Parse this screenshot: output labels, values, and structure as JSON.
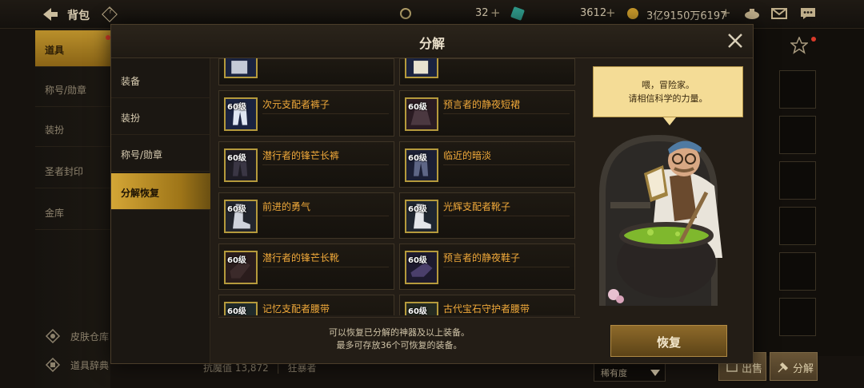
{
  "topbar": {
    "title": "背包",
    "currency1": "32",
    "currency2": "3612",
    "currency3": "3亿9150万6197",
    "plus": "+"
  },
  "leftnav": {
    "items": [
      "道具",
      "称号/勋章",
      "装扮",
      "圣者封印",
      "金库"
    ],
    "bottom": [
      "皮肤仓库",
      "道具辞典"
    ]
  },
  "background": {
    "stat_label": "抗魔值 13,872",
    "stat_sep": "|",
    "stat_class": "狂暴者",
    "sort_label": "稀有度",
    "btn_bag": "出售",
    "btn_decompose": "分解"
  },
  "modal": {
    "title": "分解",
    "tabs": [
      "装备",
      "装扮",
      "称号/勋章",
      "分解恢复"
    ],
    "items": [
      {
        "level": "60级",
        "name": "次元支配者裤子"
      },
      {
        "level": "60级",
        "name": "预言者的静夜短裙"
      },
      {
        "level": "60级",
        "name": "潜行者的锋芒长裤"
      },
      {
        "level": "60级",
        "name": "临近的暗淡"
      },
      {
        "level": "60级",
        "name": "前进的勇气"
      },
      {
        "level": "60级",
        "name": "光辉支配者靴子"
      },
      {
        "level": "60级",
        "name": "潜行者的锋芒长靴"
      },
      {
        "level": "60级",
        "name": "预言者的静夜鞋子"
      },
      {
        "level": "60级",
        "name": "记忆支配者腰带"
      },
      {
        "level": "60级",
        "name": "古代宝石守护者腰带"
      }
    ],
    "footer_line1": "可以恢复已分解的神器及以上装备。",
    "footer_line2": "最多可存放36个可恢复的装备。",
    "npc_line1": "喂，冒险家。",
    "npc_line2": "请相信科学的力量。",
    "restore_label": "恢复"
  },
  "colors": {
    "accent_gold": "#c9982c",
    "item_name": "#f0a93a",
    "bubble": "#f4dc96"
  }
}
